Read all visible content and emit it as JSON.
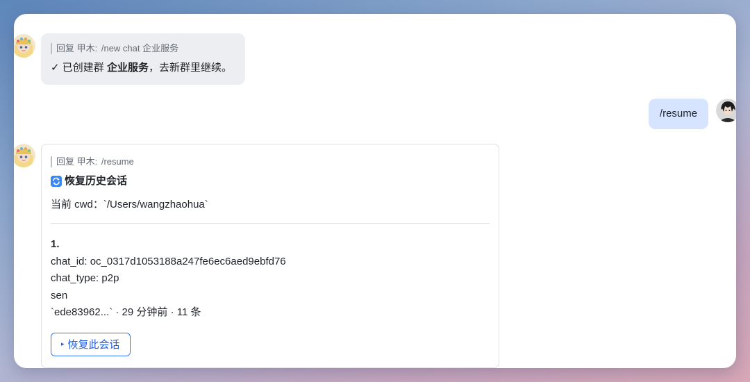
{
  "messages": {
    "m1": {
      "quote_label": "回复 甲木:",
      "quote_text": "/new chat 企业服务",
      "check_mark": "✓",
      "text_before": "已创建群",
      "group_name": "企业服务",
      "text_after": "，去新群里继续。"
    },
    "m2": {
      "text": "/resume"
    },
    "m3": {
      "quote_label": "回复 甲木:",
      "quote_text": "/resume",
      "title": "恢复历史会话",
      "cwd_line": "当前 cwd：`/Users/wangzhaohua`",
      "entry": {
        "index": "1.",
        "chat_id": "chat_id: oc_0317d1053188a247fe6ec6aed9ebfd76",
        "chat_type": "chat_type: p2p",
        "name": "sen",
        "meta": "`ede83962...` · 29 分钟前 · 11 条"
      },
      "button_marker": "▸",
      "button_label": "恢复此会话"
    }
  },
  "colors": {
    "bot_bubble": "#eceef1",
    "user_bubble": "#d6e4ff",
    "accent": "#3370ff"
  },
  "icons": {
    "bot_avatar": "bot-avatar",
    "user_avatar": "user-avatar",
    "card_title_icon": "reload-icon"
  }
}
